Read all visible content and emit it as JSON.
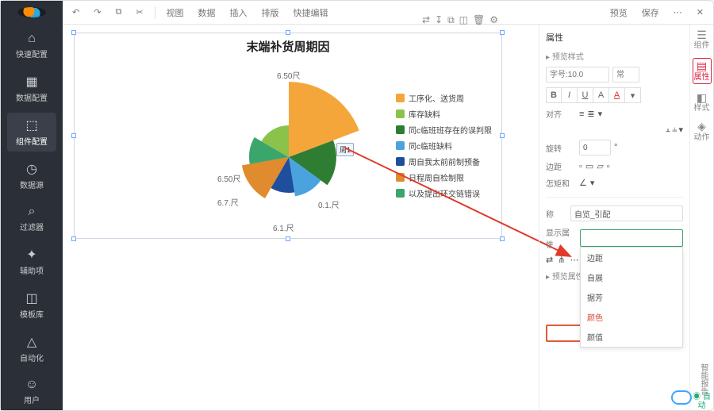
{
  "toolbar": {
    "undo": "↶",
    "redo": "↷",
    "copy": "⧉",
    "cut": "✂",
    "menu": [
      "视图",
      "数据",
      "插入",
      "排版",
      "快捷编辑"
    ],
    "right": [
      "预览",
      "保存",
      "⋯",
      "✕"
    ]
  },
  "leftbar": {
    "items": [
      {
        "icon": "⌂",
        "label": "快速配置"
      },
      {
        "icon": "▦",
        "label": "数据配置"
      },
      {
        "icon": "⬚",
        "label": "组件配置",
        "active": true
      },
      {
        "icon": "◷",
        "label": "数据源"
      },
      {
        "icon": "⌕",
        "label": "过滤器"
      },
      {
        "icon": "✦",
        "label": "辅助项"
      },
      {
        "icon": "◫",
        "label": "模板库"
      },
      {
        "icon": "△",
        "label": "自动化"
      },
      {
        "icon": "☺",
        "label": "用户"
      }
    ]
  },
  "chart_data": {
    "type": "pie",
    "title": "末端补货周期因",
    "series": [
      {
        "name": "工序化、送货周",
        "value": 50.4,
        "color": "#f4a63a"
      },
      {
        "name": "库存缺料",
        "value": 3.0,
        "color": "#8bc34a"
      },
      {
        "name": "同c临班班存在的误判限",
        "value": 15.0,
        "color": "#2e7d32"
      },
      {
        "name": "同c临班缺料",
        "value": 8.4,
        "color": "#4aa3df"
      },
      {
        "name": "周自我太前前制预备",
        "value": 7.2,
        "color": "#1f4e9c"
      },
      {
        "name": "日程周自检制限",
        "value": 10.5,
        "color": "#e08b2d"
      },
      {
        "name": "以及提出环交链错误",
        "value": 5.5,
        "color": "#3aa66b"
      }
    ],
    "slice_labels": [
      "6.50尺",
      "6.50尺",
      "6.1.尺",
      "0.1.尺",
      "6.7.尺"
    ],
    "data_label": "周1"
  },
  "floaticons": [
    "⇄",
    "↧",
    "⧉",
    "◫",
    "🗑",
    "⚙"
  ],
  "rightpanel": {
    "title": "属性",
    "section1": "预览样式",
    "fontsize_ph": "字号:10.0",
    "fontstyle_ph": "常",
    "align_label": "对齐",
    "rotate_label": "旋转",
    "rotate_value": "0",
    "rotate_unit": "°",
    "margin_label": "边距",
    "linewrap_label": "怎矩和",
    "name_label": "称",
    "name_value": "自览_引配",
    "showprop_label": "显示属性",
    "dropdown_placeholder": "",
    "dropdown_options": [
      "边距",
      "自展",
      "据芳",
      "颜色",
      "颜值"
    ],
    "section2": "预览属性"
  },
  "toolrail": {
    "items": [
      {
        "icon": "☰",
        "label": "组件"
      },
      {
        "icon": "▤",
        "label": "属性",
        "active": true
      },
      {
        "icon": "◧",
        "label": "样式"
      },
      {
        "icon": "◈",
        "label": "动作"
      }
    ],
    "switch_label": "自动"
  },
  "assistant_label": "智能报告"
}
